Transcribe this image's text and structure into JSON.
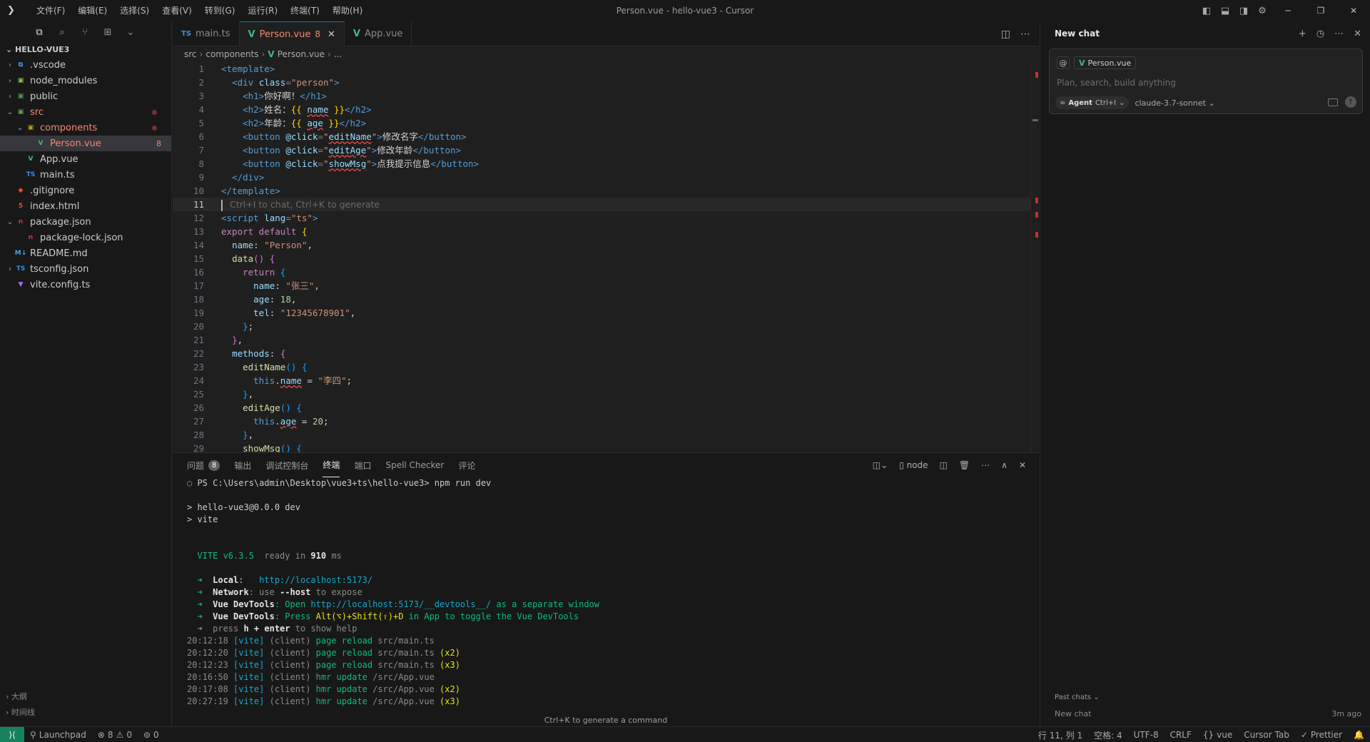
{
  "window": {
    "title": "Person.vue - hello-vue3 - Cursor",
    "menu": [
      "文件(F)",
      "编辑(E)",
      "选择(S)",
      "查看(V)",
      "转到(G)",
      "运行(R)",
      "终端(T)",
      "帮助(H)"
    ]
  },
  "explorer": {
    "project": "HELLO-VUE3",
    "items": [
      {
        "name": ".vscode",
        "depth": 0,
        "chev": "›",
        "icon": "vscode-folder-icon",
        "glyph": "⧉",
        "color": "#3b8eea",
        "state": ""
      },
      {
        "name": "node_modules",
        "depth": 0,
        "chev": "›",
        "icon": "node-folder-icon",
        "glyph": "▣",
        "color": "#8bc34a",
        "state": ""
      },
      {
        "name": "public",
        "depth": 0,
        "chev": "›",
        "icon": "public-folder-icon",
        "glyph": "▣",
        "color": "#43a047",
        "state": ""
      },
      {
        "name": "src",
        "depth": 0,
        "chev": "⌄",
        "icon": "src-folder-icon",
        "glyph": "▣",
        "color": "#4caf50",
        "state": "err"
      },
      {
        "name": "components",
        "depth": 1,
        "chev": "⌄",
        "icon": "components-folder-icon",
        "glyph": "▣",
        "color": "#c0a000",
        "state": "err"
      },
      {
        "name": "Person.vue",
        "depth": 2,
        "chev": "",
        "icon": "vue-file-icon",
        "glyph": "V",
        "color": "#41b883",
        "state": "selected",
        "badge": "8"
      },
      {
        "name": "App.vue",
        "depth": 1,
        "chev": "",
        "icon": "vue-file-icon",
        "glyph": "V",
        "color": "#41b883",
        "state": ""
      },
      {
        "name": "main.ts",
        "depth": 1,
        "chev": "",
        "icon": "ts-file-icon",
        "glyph": "TS",
        "color": "#3b8eea",
        "state": ""
      },
      {
        "name": ".gitignore",
        "depth": 0,
        "chev": "",
        "icon": "git-file-icon",
        "glyph": "◆",
        "color": "#e84d31",
        "state": ""
      },
      {
        "name": "index.html",
        "depth": 0,
        "chev": "",
        "icon": "html-file-icon",
        "glyph": "5",
        "color": "#e44d26",
        "state": ""
      },
      {
        "name": "package.json",
        "depth": 0,
        "chev": "⌄",
        "icon": "npm-file-icon",
        "glyph": "n",
        "color": "#cb3837",
        "state": ""
      },
      {
        "name": "package-lock.json",
        "depth": 1,
        "chev": "",
        "icon": "npm-file-icon",
        "glyph": "n",
        "color": "#cb3837",
        "state": ""
      },
      {
        "name": "README.md",
        "depth": 0,
        "chev": "",
        "icon": "markdown-file-icon",
        "glyph": "M↓",
        "color": "#42a5f5",
        "state": ""
      },
      {
        "name": "tsconfig.json",
        "depth": 0,
        "chev": "›",
        "icon": "tsconfig-file-icon",
        "glyph": "TS",
        "color": "#3b8eea",
        "state": ""
      },
      {
        "name": "vite.config.ts",
        "depth": 0,
        "chev": "",
        "icon": "vite-file-icon",
        "glyph": "▼",
        "color": "#a86cff",
        "state": ""
      }
    ],
    "bottom_sections": [
      "大纲",
      "时间线"
    ]
  },
  "tabs": [
    {
      "label": "main.ts",
      "type": "ts",
      "active": false
    },
    {
      "label": "Person.vue",
      "type": "vue",
      "active": true,
      "count": "8"
    },
    {
      "label": "App.vue",
      "type": "vue",
      "active": false
    }
  ],
  "breadcrumb": [
    "src",
    "components",
    "Person.vue",
    "..."
  ],
  "editor": {
    "current_line": 11,
    "inline_hint": "Ctrl+I to chat, Ctrl+K to generate",
    "lines": [
      [
        [
          "<template>",
          "t-tag"
        ]
      ],
      [
        [
          "  ",
          ""
        ],
        [
          "<div ",
          "t-tag"
        ],
        [
          "class",
          "t-attr"
        ],
        [
          "=",
          "t-punct"
        ],
        [
          "\"person\"",
          "t-str"
        ],
        [
          ">",
          "t-tag"
        ]
      ],
      [
        [
          "    ",
          ""
        ],
        [
          "<h1>",
          "t-tag"
        ],
        [
          "你好啊！",
          ""
        ],
        [
          "</h1>",
          "t-tag"
        ]
      ],
      [
        [
          "    ",
          ""
        ],
        [
          "<h2>",
          "t-tag"
        ],
        [
          "姓名：",
          ""
        ],
        [
          "{{ ",
          "t-br"
        ],
        [
          "name",
          "t-prop squig"
        ],
        [
          " }}",
          "t-br"
        ],
        [
          "</h2>",
          "t-tag"
        ]
      ],
      [
        [
          "    ",
          ""
        ],
        [
          "<h2>",
          "t-tag"
        ],
        [
          "年龄：",
          ""
        ],
        [
          "{{ ",
          "t-br"
        ],
        [
          "age",
          "t-prop squig"
        ],
        [
          " }}",
          "t-br"
        ],
        [
          "</h2>",
          "t-tag"
        ]
      ],
      [
        [
          "    ",
          ""
        ],
        [
          "<button ",
          "t-tag"
        ],
        [
          "@click",
          "t-attr"
        ],
        [
          "=",
          "t-punct"
        ],
        [
          "\"",
          "t-str"
        ],
        [
          "editName",
          "t-prop squig"
        ],
        [
          "\"",
          "t-str"
        ],
        [
          ">",
          "t-tag"
        ],
        [
          "修改名字",
          ""
        ],
        [
          "</button>",
          "t-tag"
        ]
      ],
      [
        [
          "    ",
          ""
        ],
        [
          "<button ",
          "t-tag"
        ],
        [
          "@click",
          "t-attr"
        ],
        [
          "=",
          "t-punct"
        ],
        [
          "\"",
          "t-str"
        ],
        [
          "editAge",
          "t-prop squig"
        ],
        [
          "\"",
          "t-str"
        ],
        [
          ">",
          "t-tag"
        ],
        [
          "修改年龄",
          ""
        ],
        [
          "</button>",
          "t-tag"
        ]
      ],
      [
        [
          "    ",
          ""
        ],
        [
          "<button ",
          "t-tag"
        ],
        [
          "@click",
          "t-attr"
        ],
        [
          "=",
          "t-punct"
        ],
        [
          "\"",
          "t-str"
        ],
        [
          "showMsg",
          "t-prop squig"
        ],
        [
          "\"",
          "t-str"
        ],
        [
          ">",
          "t-tag"
        ],
        [
          "点我提示信息",
          ""
        ],
        [
          "</button>",
          "t-tag"
        ]
      ],
      [
        [
          "  ",
          ""
        ],
        [
          "</div>",
          "t-tag"
        ]
      ],
      [
        [
          "</template>",
          "t-tag"
        ]
      ],
      [],
      [
        [
          "<script ",
          "t-tag"
        ],
        [
          "lang",
          "t-attr"
        ],
        [
          "=",
          "t-punct"
        ],
        [
          "\"ts\"",
          "t-str"
        ],
        [
          ">",
          "t-tag"
        ]
      ],
      [
        [
          "export default ",
          "t-kw"
        ],
        [
          "{",
          "t-br"
        ]
      ],
      [
        [
          "  ",
          ""
        ],
        [
          "name",
          "t-prop"
        ],
        [
          ": ",
          ""
        ],
        [
          "\"Person\"",
          "t-str"
        ],
        [
          ",",
          ""
        ]
      ],
      [
        [
          "  ",
          ""
        ],
        [
          "data",
          "t-fn"
        ],
        [
          "() ",
          "t-br2"
        ],
        [
          "{",
          "t-br2"
        ]
      ],
      [
        [
          "    ",
          ""
        ],
        [
          "return ",
          "t-kw"
        ],
        [
          "{",
          "t-br3"
        ]
      ],
      [
        [
          "      ",
          ""
        ],
        [
          "name",
          "t-prop"
        ],
        [
          ": ",
          ""
        ],
        [
          "\"张三\"",
          "t-str"
        ],
        [
          ",",
          ""
        ]
      ],
      [
        [
          "      ",
          ""
        ],
        [
          "age",
          "t-prop"
        ],
        [
          ": ",
          ""
        ],
        [
          "18",
          "t-num"
        ],
        [
          ",",
          ""
        ]
      ],
      [
        [
          "      ",
          ""
        ],
        [
          "tel",
          "t-prop"
        ],
        [
          ": ",
          ""
        ],
        [
          "\"12345678901\"",
          "t-str"
        ],
        [
          ",",
          ""
        ]
      ],
      [
        [
          "    ",
          ""
        ],
        [
          "}",
          "t-br3"
        ],
        [
          ";",
          ""
        ]
      ],
      [
        [
          "  ",
          ""
        ],
        [
          "}",
          "t-br2"
        ],
        [
          ",",
          ""
        ]
      ],
      [
        [
          "  ",
          ""
        ],
        [
          "methods",
          "t-prop"
        ],
        [
          ": ",
          ""
        ],
        [
          "{",
          "t-br2"
        ]
      ],
      [
        [
          "    ",
          ""
        ],
        [
          "editName",
          "t-fn"
        ],
        [
          "() ",
          "t-br3"
        ],
        [
          "{",
          "t-br3"
        ]
      ],
      [
        [
          "      ",
          ""
        ],
        [
          "this",
          "t-key"
        ],
        [
          ".",
          ""
        ],
        [
          "name",
          "t-prop squig"
        ],
        [
          " = ",
          ""
        ],
        [
          "\"李四\"",
          "t-str"
        ],
        [
          ";",
          ""
        ]
      ],
      [
        [
          "    ",
          ""
        ],
        [
          "}",
          "t-br3"
        ],
        [
          ",",
          ""
        ]
      ],
      [
        [
          "    ",
          ""
        ],
        [
          "editAge",
          "t-fn"
        ],
        [
          "() ",
          "t-br3"
        ],
        [
          "{",
          "t-br3"
        ]
      ],
      [
        [
          "      ",
          ""
        ],
        [
          "this",
          "t-key"
        ],
        [
          ".",
          ""
        ],
        [
          "age",
          "t-prop squig"
        ],
        [
          " = ",
          ""
        ],
        [
          "20",
          "t-num"
        ],
        [
          ";",
          ""
        ]
      ],
      [
        [
          "    ",
          ""
        ],
        [
          "}",
          "t-br3"
        ],
        [
          ",",
          ""
        ]
      ],
      [
        [
          "    ",
          ""
        ],
        [
          "showMsg",
          "t-fn"
        ],
        [
          "() ",
          "t-br3"
        ],
        [
          "{",
          "t-br3"
        ]
      ]
    ]
  },
  "panel": {
    "tabs": [
      "问题",
      "输出",
      "调试控制台",
      "终端",
      "端口",
      "Spell Checker",
      "评论"
    ],
    "problems_count": "8",
    "active_tab": "终端",
    "terminal_name": "node",
    "footer_hint": "Ctrl+K to generate a command",
    "terminal_lines": [
      [
        [
          "○ ",
          "c-dim"
        ],
        [
          "PS C:\\Users\\admin\\Desktop\\vue3+ts\\hello-vue3> ",
          ""
        ],
        [
          "npm run dev",
          ""
        ]
      ],
      [],
      [
        [
          "> hello-vue3@0.0.0 dev",
          ""
        ]
      ],
      [
        [
          "> vite",
          ""
        ]
      ],
      [],
      [],
      [
        [
          "  VITE v6.3.5",
          "c-vite"
        ],
        [
          "  ready in ",
          "c-dim"
        ],
        [
          "910",
          "c-bold"
        ],
        [
          " ms",
          "c-dim"
        ]
      ],
      [],
      [
        [
          "  ➜  ",
          "c-green"
        ],
        [
          "Local",
          "c-bold"
        ],
        [
          ":   ",
          ""
        ],
        [
          "http://localhost:5173/",
          "c-cyan"
        ]
      ],
      [
        [
          "  ➜  ",
          "c-green"
        ],
        [
          "Network",
          "c-bold"
        ],
        [
          ": use ",
          "c-dim"
        ],
        [
          "--host",
          "c-bold"
        ],
        [
          " to expose",
          "c-dim"
        ]
      ],
      [
        [
          "  ➜  ",
          "c-green"
        ],
        [
          "Vue DevTools",
          "c-bold"
        ],
        [
          ": Open ",
          "c-green"
        ],
        [
          "http://localhost:5173/__devtools__/",
          "c-cyan"
        ],
        [
          " as a separate window",
          "c-green"
        ]
      ],
      [
        [
          "  ➜  ",
          "c-green"
        ],
        [
          "Vue DevTools",
          "c-bold"
        ],
        [
          ": Press ",
          "c-green"
        ],
        [
          "Alt(⌥)+Shift(⇧)+D",
          "c-yellow"
        ],
        [
          " in App to toggle the Vue DevTools",
          "c-green"
        ]
      ],
      [
        [
          "  ➜  press ",
          "c-dim"
        ],
        [
          "h + enter",
          "c-bold"
        ],
        [
          " to show help",
          "c-dim"
        ]
      ],
      [
        [
          "20:12:18 ",
          "c-dim"
        ],
        [
          "[vite]",
          "c-cyan"
        ],
        [
          " (client) ",
          "c-dim"
        ],
        [
          "page reload ",
          "c-green"
        ],
        [
          "src/main.ts",
          "c-dim"
        ]
      ],
      [
        [
          "20:12:20 ",
          "c-dim"
        ],
        [
          "[vite]",
          "c-cyan"
        ],
        [
          " (client) ",
          "c-dim"
        ],
        [
          "page reload ",
          "c-green"
        ],
        [
          "src/main.ts ",
          "c-dim"
        ],
        [
          "(x2)",
          "c-yellow"
        ]
      ],
      [
        [
          "20:12:23 ",
          "c-dim"
        ],
        [
          "[vite]",
          "c-cyan"
        ],
        [
          " (client) ",
          "c-dim"
        ],
        [
          "page reload ",
          "c-green"
        ],
        [
          "src/main.ts ",
          "c-dim"
        ],
        [
          "(x3)",
          "c-yellow"
        ]
      ],
      [
        [
          "20:16:50 ",
          "c-dim"
        ],
        [
          "[vite]",
          "c-cyan"
        ],
        [
          " (client) ",
          "c-dim"
        ],
        [
          "hmr update ",
          "c-green"
        ],
        [
          "/src/App.vue",
          "c-dim"
        ]
      ],
      [
        [
          "20:17:08 ",
          "c-dim"
        ],
        [
          "[vite]",
          "c-cyan"
        ],
        [
          " (client) ",
          "c-dim"
        ],
        [
          "hmr update ",
          "c-green"
        ],
        [
          "/src/App.vue ",
          "c-dim"
        ],
        [
          "(x2)",
          "c-yellow"
        ]
      ],
      [
        [
          "20:27:19 ",
          "c-dim"
        ],
        [
          "[vite]",
          "c-cyan"
        ],
        [
          " (client) ",
          "c-dim"
        ],
        [
          "hmr update ",
          "c-green"
        ],
        [
          "/src/App.vue ",
          "c-dim"
        ],
        [
          "(x3)",
          "c-yellow"
        ]
      ]
    ]
  },
  "chat": {
    "title": "New chat",
    "context_file": "Person.vue",
    "placeholder": "Plan, search, build anything",
    "agent_label": "Agent",
    "agent_shortcut": "Ctrl+I",
    "model": "claude-3.7-sonnet",
    "past_chats_label": "Past chats",
    "past_chat_title": "New chat",
    "past_chat_time": "3m ago"
  },
  "status": {
    "launchpad": "Launchpad",
    "errors": "8",
    "warnings": "0",
    "ports": "0",
    "position": "行 11, 列 1",
    "spaces": "空格: 4",
    "encoding": "UTF-8",
    "eol": "CRLF",
    "language": "vue",
    "cursor_tab": "Cursor Tab",
    "prettier": "Prettier"
  }
}
